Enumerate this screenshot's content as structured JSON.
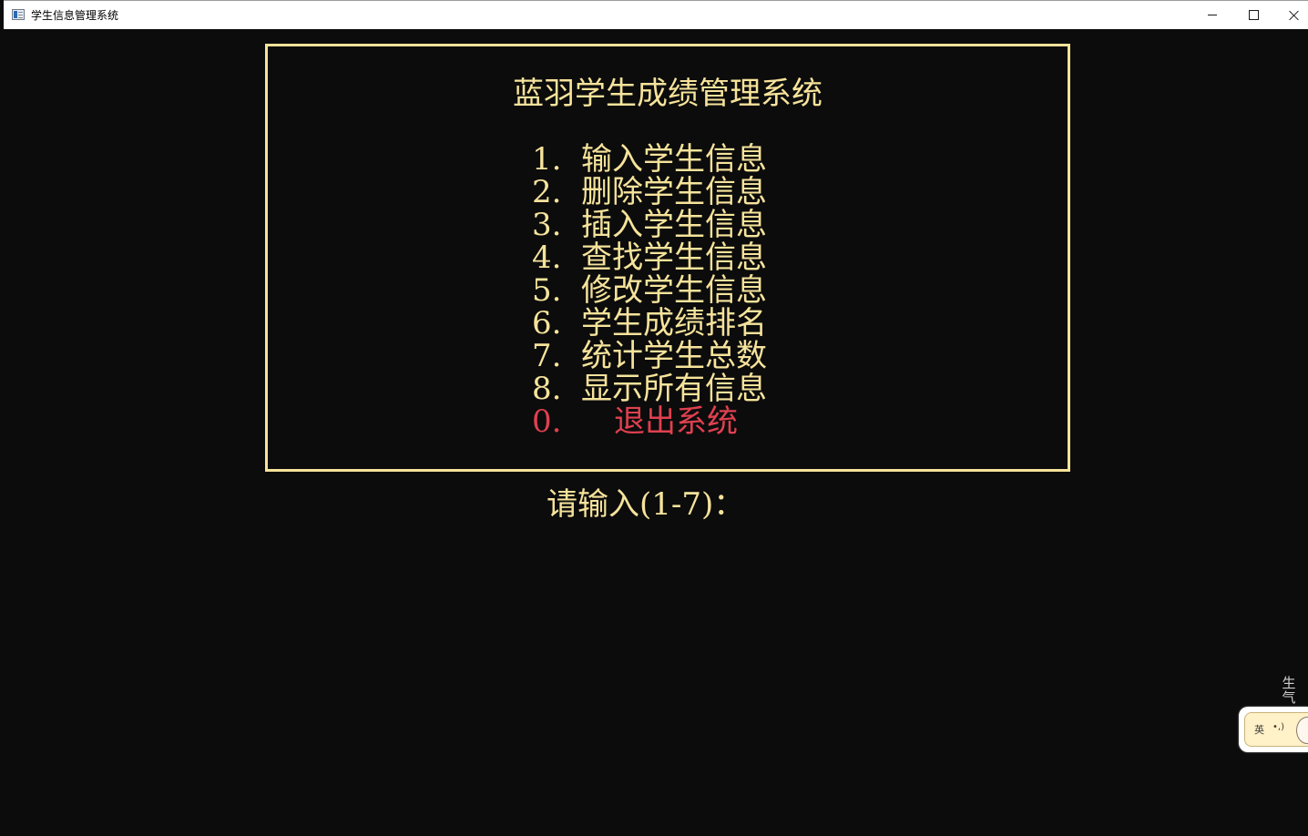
{
  "window": {
    "title": "学生信息管理系统",
    "icon": "console-app-icon",
    "controls": {
      "minimize_icon": "minimize-icon",
      "maximize_icon": "maximize-icon",
      "close_icon": "close-icon"
    }
  },
  "menu": {
    "title": "蓝羽学生成绩管理系统",
    "items": [
      {
        "num": "1.",
        "label": "输入学生信息"
      },
      {
        "num": "2.",
        "label": "删除学生信息"
      },
      {
        "num": "3.",
        "label": "插入学生信息"
      },
      {
        "num": "4.",
        "label": "查找学生信息"
      },
      {
        "num": "5.",
        "label": "修改学生信息"
      },
      {
        "num": "6.",
        "label": "学生成绩排名"
      },
      {
        "num": "7.",
        "label": "统计学生总数"
      },
      {
        "num": "8.",
        "label": "显示所有信息"
      },
      {
        "num": "0.",
        "label": "退出系统"
      }
    ]
  },
  "prompt": "请输入(1-7)：",
  "ime": {
    "lang": "英",
    "face": "•,)",
    "float_text": "生气"
  },
  "colors": {
    "background": "#0c0c0c",
    "text": "#f6e39b",
    "border": "#f6e39b",
    "exit": "#e0404f"
  }
}
